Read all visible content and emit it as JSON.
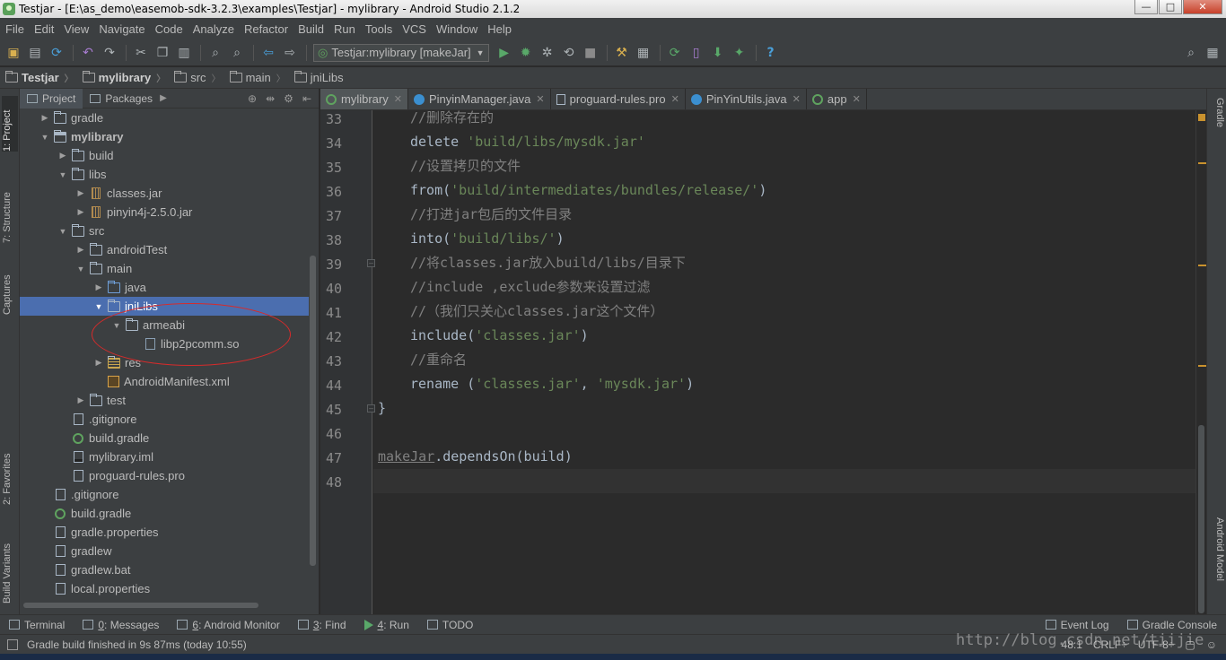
{
  "window": {
    "title": "Testjar - [E:\\as_demo\\easemob-sdk-3.2.3\\examples\\Testjar] - mylibrary - Android Studio 2.1.2",
    "controls": {
      "minimize": "—",
      "maximize": "□",
      "close": "✕"
    }
  },
  "menu": [
    "File",
    "Edit",
    "View",
    "Navigate",
    "Code",
    "Analyze",
    "Refactor",
    "Build",
    "Run",
    "Tools",
    "VCS",
    "Window",
    "Help"
  ],
  "toolbar": {
    "run_config": "Testjar:mylibrary [makeJar]",
    "icons": [
      "open-icon",
      "save-icon",
      "sync-icon",
      "undo-icon",
      "redo-icon",
      "cut-icon",
      "copy-icon",
      "paste-icon",
      "find-icon",
      "replace-icon",
      "back-icon",
      "forward-icon",
      "run-icon",
      "debug-icon",
      "attach-icon",
      "stop-icon",
      "sdk-manager-icon",
      "help-icon"
    ]
  },
  "breadcrumb": [
    "Testjar",
    "mylibrary",
    "src",
    "main",
    "jniLibs"
  ],
  "left_tool_windows": [
    "1: Project",
    "7: Structure",
    "Captures",
    "2: Favorites",
    "Build Variants"
  ],
  "right_tool_windows": [
    "Gradle",
    "Android Model"
  ],
  "project_panel": {
    "tabs": [
      "Project",
      "Packages"
    ],
    "tree": [
      {
        "label": "gradle",
        "depth": 1,
        "icon": "folder",
        "arrow": "▶"
      },
      {
        "label": "mylibrary",
        "depth": 1,
        "icon": "module",
        "arrow": "▼",
        "bold": true
      },
      {
        "label": "build",
        "depth": 2,
        "icon": "folder",
        "arrow": "▶"
      },
      {
        "label": "libs",
        "depth": 2,
        "icon": "folder",
        "arrow": "▼"
      },
      {
        "label": "classes.jar",
        "depth": 3,
        "icon": "jar",
        "arrow": "▶"
      },
      {
        "label": "pinyin4j-2.5.0.jar",
        "depth": 3,
        "icon": "jar",
        "arrow": "▶"
      },
      {
        "label": "src",
        "depth": 2,
        "icon": "folder",
        "arrow": "▼"
      },
      {
        "label": "androidTest",
        "depth": 3,
        "icon": "folder",
        "arrow": "▶"
      },
      {
        "label": "main",
        "depth": 3,
        "icon": "folder",
        "arrow": "▼"
      },
      {
        "label": "java",
        "depth": 4,
        "icon": "blue",
        "arrow": "▶"
      },
      {
        "label": "jniLibs",
        "depth": 4,
        "icon": "folder",
        "arrow": "▼",
        "selected": true
      },
      {
        "label": "armeabi",
        "depth": 5,
        "icon": "folder",
        "arrow": "▼"
      },
      {
        "label": "libp2pcomm.so",
        "depth": 6,
        "icon": "so",
        "arrow": ""
      },
      {
        "label": "res",
        "depth": 4,
        "icon": "res",
        "arrow": "▶"
      },
      {
        "label": "AndroidManifest.xml",
        "depth": 4,
        "icon": "xml",
        "arrow": ""
      },
      {
        "label": "test",
        "depth": 3,
        "icon": "folder",
        "arrow": "▶"
      },
      {
        "label": ".gitignore",
        "depth": 2,
        "icon": "file",
        "arrow": ""
      },
      {
        "label": "build.gradle",
        "depth": 2,
        "icon": "gradle",
        "arrow": ""
      },
      {
        "label": "mylibrary.iml",
        "depth": 2,
        "icon": "iml",
        "arrow": ""
      },
      {
        "label": "proguard-rules.pro",
        "depth": 2,
        "icon": "file",
        "arrow": ""
      },
      {
        "label": ".gitignore",
        "depth": 1,
        "icon": "file",
        "arrow": ""
      },
      {
        "label": "build.gradle",
        "depth": 1,
        "icon": "gradle",
        "arrow": ""
      },
      {
        "label": "gradle.properties",
        "depth": 1,
        "icon": "file",
        "arrow": ""
      },
      {
        "label": "gradlew",
        "depth": 1,
        "icon": "file",
        "arrow": ""
      },
      {
        "label": "gradlew.bat",
        "depth": 1,
        "icon": "file",
        "arrow": ""
      },
      {
        "label": "local.properties",
        "depth": 1,
        "icon": "file",
        "arrow": ""
      }
    ]
  },
  "editor": {
    "tabs": [
      {
        "label": "mylibrary",
        "icon": "g",
        "active": true
      },
      {
        "label": "PinyinManager.java",
        "icon": "c"
      },
      {
        "label": "proguard-rules.pro",
        "icon": "f"
      },
      {
        "label": "PinYinUtils.java",
        "icon": "c"
      },
      {
        "label": "app",
        "icon": "g"
      }
    ],
    "lines": [
      {
        "n": "33",
        "parts": [
          [
            "cm",
            "//删除存在的"
          ]
        ]
      },
      {
        "n": "34",
        "parts": [
          [
            "kw",
            "delete "
          ],
          [
            "st",
            "'build/libs/mysdk.jar'"
          ]
        ]
      },
      {
        "n": "35",
        "parts": [
          [
            "cm",
            "//设置拷贝的文件"
          ]
        ]
      },
      {
        "n": "36",
        "parts": [
          [
            "kw",
            "from("
          ],
          [
            "st",
            "'build/intermediates/bundles/release/'"
          ],
          [
            "kw",
            ")"
          ]
        ]
      },
      {
        "n": "37",
        "parts": [
          [
            "cm",
            "//打进jar包后的文件目录"
          ]
        ]
      },
      {
        "n": "38",
        "parts": [
          [
            "kw",
            "into("
          ],
          [
            "st",
            "'build/libs/'"
          ],
          [
            "kw",
            ")"
          ]
        ]
      },
      {
        "n": "39",
        "parts": [
          [
            "cm",
            "//将classes.jar放入build/libs/目录下"
          ]
        ]
      },
      {
        "n": "40",
        "parts": [
          [
            "cm",
            "//include ,exclude参数来设置过滤"
          ]
        ]
      },
      {
        "n": "41",
        "parts": [
          [
            "cm",
            "//（我们只关心classes.jar这个文件）"
          ]
        ]
      },
      {
        "n": "42",
        "parts": [
          [
            "kw",
            "include("
          ],
          [
            "st",
            "'classes.jar'"
          ],
          [
            "kw",
            ")"
          ]
        ]
      },
      {
        "n": "43",
        "parts": [
          [
            "cm",
            "//重命名"
          ]
        ]
      },
      {
        "n": "44",
        "parts": [
          [
            "kw",
            "rename ("
          ],
          [
            "st",
            "'classes.jar'"
          ],
          [
            "kw",
            ", "
          ],
          [
            "st",
            "'mysdk.jar'"
          ],
          [
            "kw",
            ")"
          ]
        ]
      },
      {
        "n": "45",
        "parts": [
          [
            "kw",
            "}"
          ]
        ]
      },
      {
        "n": "46",
        "parts": []
      },
      {
        "n": "47",
        "parts": [
          [
            "dm",
            "makeJar"
          ],
          [
            "kw",
            ".dependsOn(build)"
          ]
        ]
      },
      {
        "n": "48",
        "parts": []
      }
    ]
  },
  "bottom_tools": [
    {
      "num": "",
      "label": "Terminal"
    },
    {
      "num": "0",
      "label": ": Messages"
    },
    {
      "num": "6",
      "label": ": Android Monitor"
    },
    {
      "num": "3",
      "label": ": Find"
    },
    {
      "num": "4",
      "label": ": Run"
    },
    {
      "num": "",
      "label": "TODO"
    }
  ],
  "bottom_right_tools": [
    "Event Log",
    "Gradle Console"
  ],
  "status": {
    "message": "Gradle build finished in 9s 87ms (today 10:55)",
    "position": "48:1",
    "line_sep": "CRLF÷",
    "encoding": "UTF-8÷"
  },
  "watermark": "http://blog.csdn.net/tiijie"
}
